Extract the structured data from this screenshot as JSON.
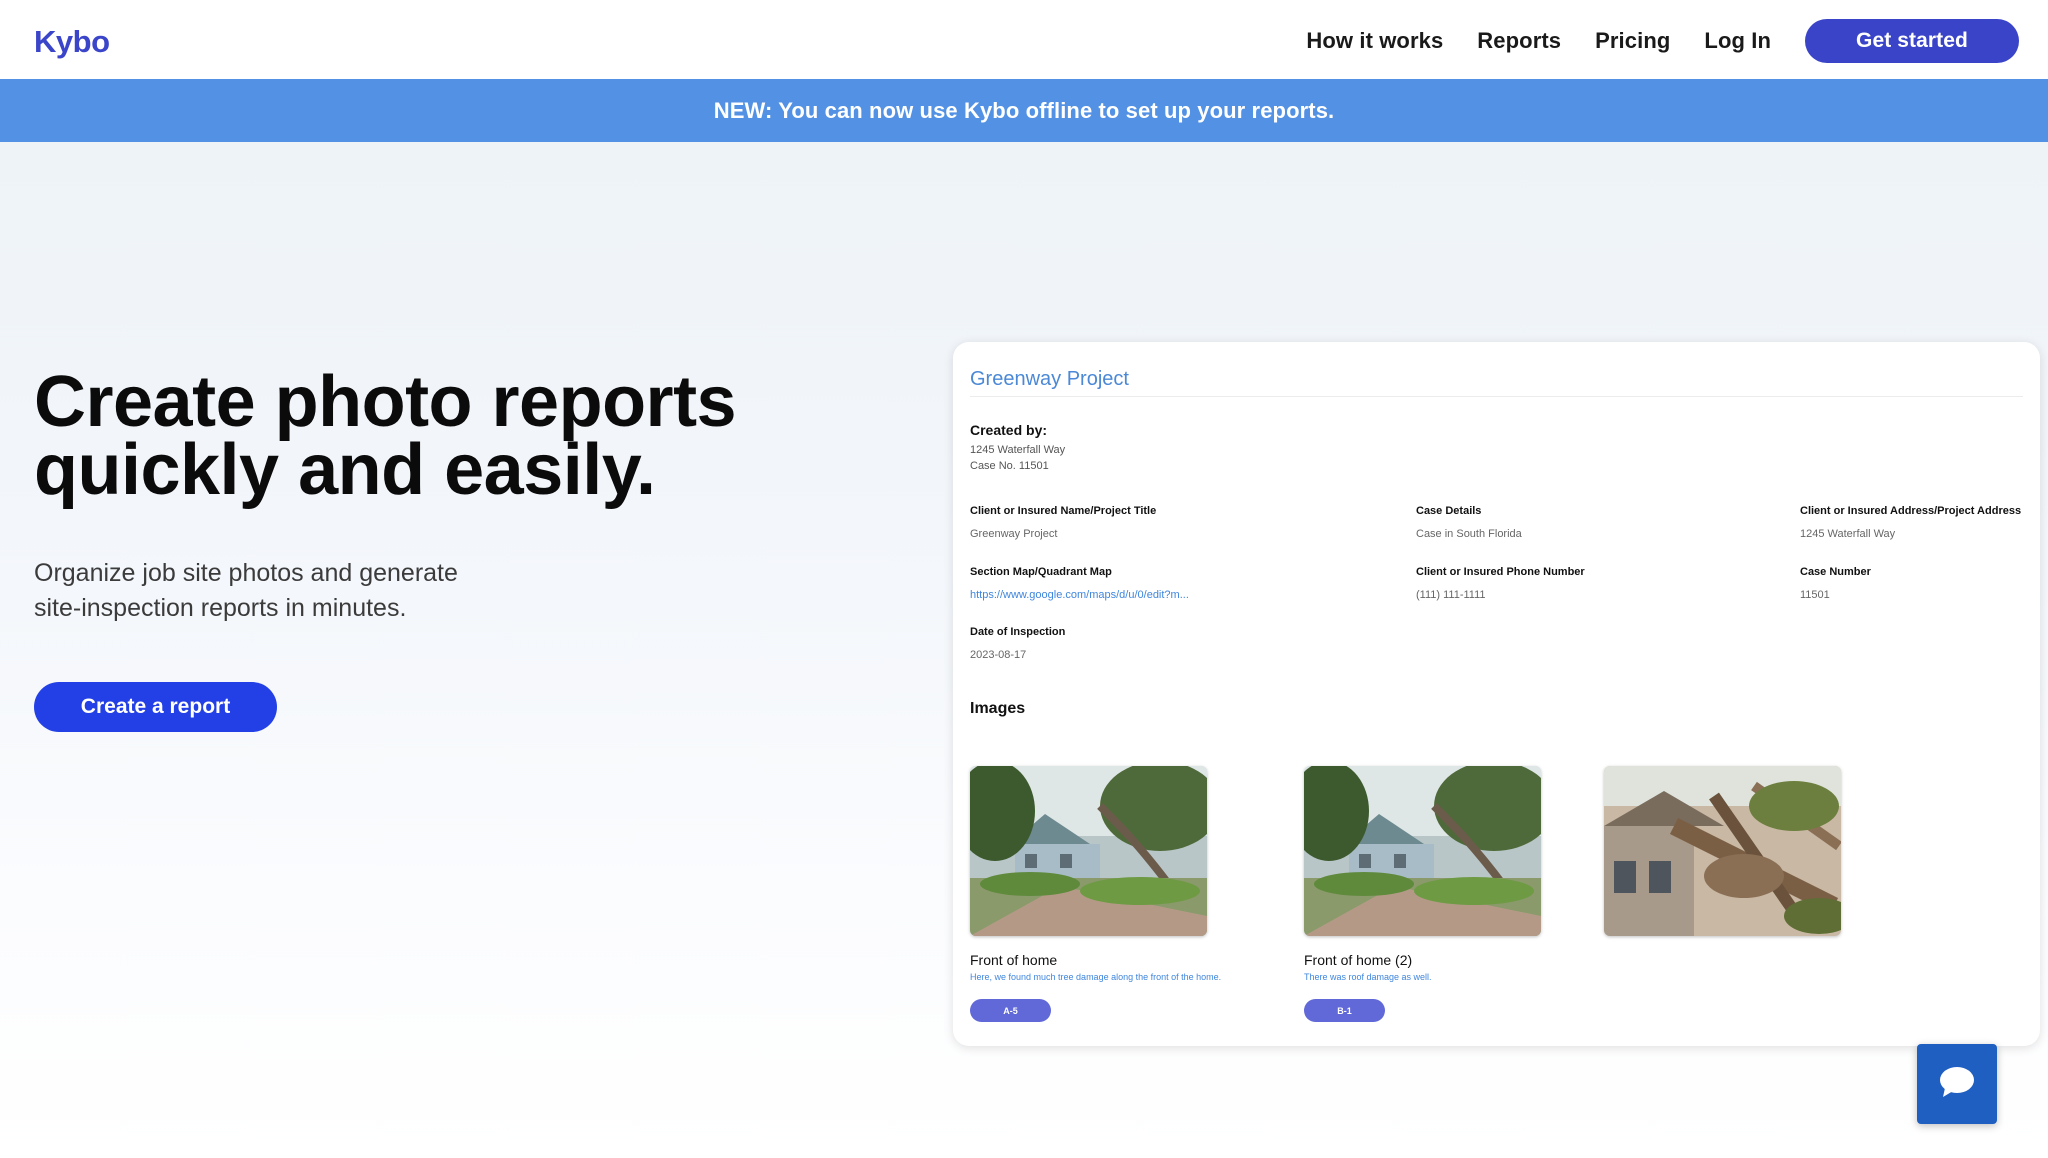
{
  "header": {
    "logo": "Kybo",
    "nav": [
      "How it works",
      "Reports",
      "Pricing",
      "Log In"
    ],
    "cta": "Get started"
  },
  "banner": {
    "text": "NEW: You can now use Kybo offline to set up your reports."
  },
  "hero": {
    "title_line1": "Create photo reports",
    "title_line2": "quickly and easily.",
    "subtitle_line1": "Organize job site photos and generate",
    "subtitle_line2": "site-inspection reports in minutes.",
    "button": "Create a report"
  },
  "report": {
    "title": "Greenway Project",
    "created_by_label": "Created by:",
    "created_by_line1": "1245 Waterfall Way",
    "created_by_line2": "Case No. 11501",
    "fields": [
      {
        "label": "Client or Insured Name/Project Title",
        "value": "Greenway Project"
      },
      {
        "label": "Case Details",
        "value": "Case in South Florida"
      },
      {
        "label": "Client or Insured Address/Project Address",
        "value": "1245 Waterfall Way"
      },
      {
        "label": "Section Map/Quadrant Map",
        "value": "https://www.google.com/maps/d/u/0/edit?m..."
      },
      {
        "label": "Client or Insured Phone Number",
        "value": "(111) 111-1111"
      },
      {
        "label": "Case Number",
        "value": "11501"
      },
      {
        "label": "Date of Inspection",
        "value": "2023-08-17"
      }
    ],
    "images_label": "Images",
    "images": [
      {
        "caption": "Front of home",
        "description": "Here, we found much tree damage along the front of the home.",
        "tag": "A-5"
      },
      {
        "caption": "Front of home (2)",
        "description": "There was roof damage as well.",
        "tag": "B-1"
      },
      {
        "caption": "",
        "description": "",
        "tag": ""
      }
    ]
  },
  "colors": {
    "brand": "#3b45c9",
    "banner": "#5291e3",
    "primary_button": "#2340e6",
    "link": "#3f86dd",
    "tag": "#6168d8",
    "chat": "#1f5fc2"
  },
  "icons": {
    "chat": "chat-bubble-icon"
  }
}
